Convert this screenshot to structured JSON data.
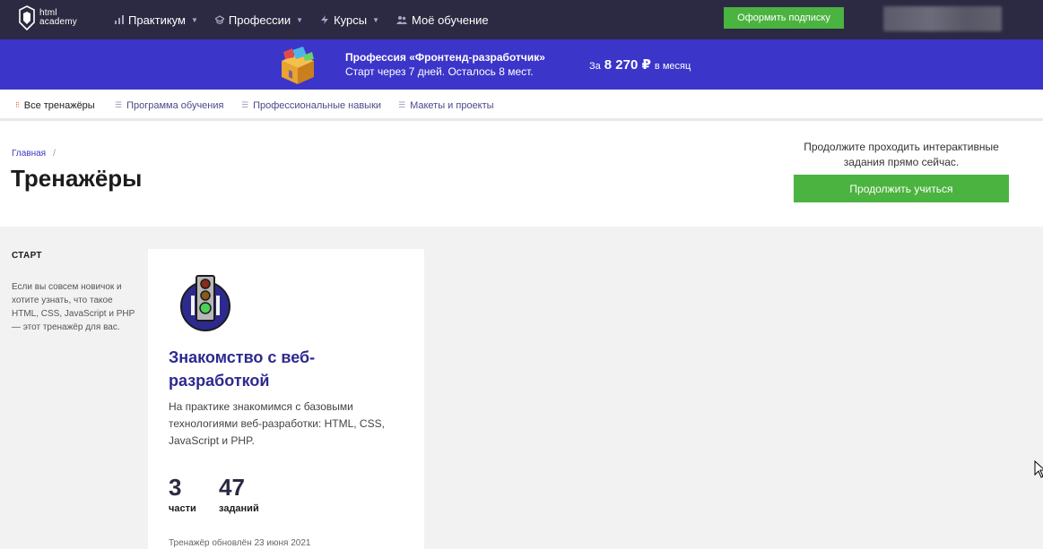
{
  "header": {
    "logo_line1": "html",
    "logo_line2": "academy",
    "nav": [
      {
        "label": "Практикум",
        "has_dropdown": true,
        "icon": "chart-icon"
      },
      {
        "label": "Профессии",
        "has_dropdown": true,
        "icon": "graduation-cap-icon"
      },
      {
        "label": "Курсы",
        "has_dropdown": true,
        "icon": "lightning-icon"
      },
      {
        "label": "Моё обучение",
        "has_dropdown": false,
        "icon": "users-icon"
      }
    ],
    "subscribe_label": "Оформить подписку"
  },
  "promo": {
    "title": "Профессия «Фронтенд-разработчик»",
    "subtitle": "Старт через 7 дней. Осталось 8 мест.",
    "price_prefix": "За",
    "price_amount": "8 270 ₽",
    "price_suffix": "в месяц"
  },
  "tabs": [
    {
      "label": "Все тренажёры",
      "active": true
    },
    {
      "label": "Программа обучения",
      "active": false
    },
    {
      "label": "Профессиональные навыки",
      "active": false
    },
    {
      "label": "Макеты и проекты",
      "active": false
    }
  ],
  "breadcrumb": {
    "home": "Главная",
    "separator": "/"
  },
  "page_title": "Тренажёры",
  "cta": {
    "text": "Продолжите проходить интерактивные задания прямо сейчас.",
    "button": "Продолжить учиться"
  },
  "section": {
    "label": "СТАРТ",
    "description": "Если вы совсем новичок и хотите узнать, что такое HTML, CSS, JavaScript и PHP — этот тренажёр для вас."
  },
  "card": {
    "title": "Знакомство с веб-разработкой",
    "description": "На практике знакомимся с базовыми технологиями веб-разработки: HTML, CSS, JavaScript и PHP.",
    "parts_value": "3",
    "parts_label": "части",
    "tasks_value": "47",
    "tasks_label": "заданий",
    "updated": "Тренажёр обновлён 23 июня 2021"
  },
  "colors": {
    "topbar": "#2b2a42",
    "promo": "#3b35c9",
    "accent_green": "#4bb33f",
    "tab_active": "#e05a2b",
    "card_title": "#2d2a8f"
  }
}
